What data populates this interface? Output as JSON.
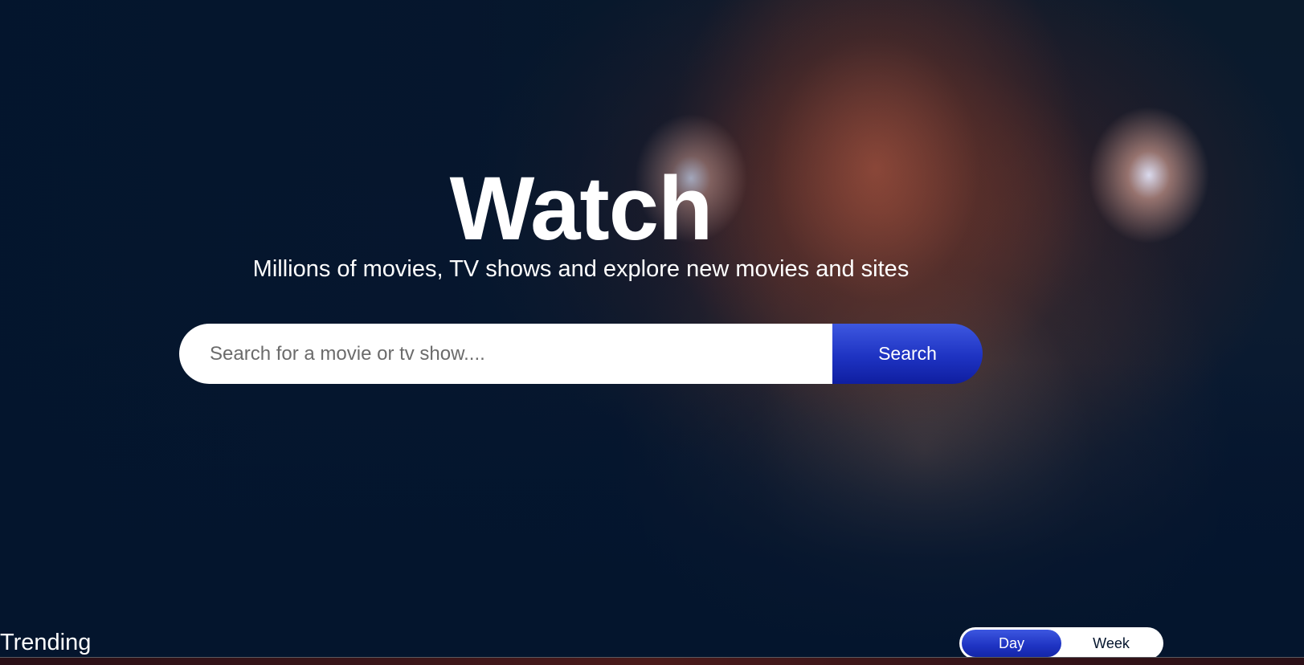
{
  "hero": {
    "title": "Watch",
    "subtitle": "Millions of movies, TV shows and explore new movies and sites"
  },
  "search": {
    "placeholder": "Search for a movie or tv show....",
    "value": "",
    "button_label": "Search"
  },
  "trending": {
    "title": "Trending",
    "toggle": [
      {
        "label": "Day",
        "active": true
      },
      {
        "label": "Week",
        "active": false
      }
    ]
  },
  "colors": {
    "background": "#04152d",
    "accent": "#1e33c2",
    "text": "#ffffff"
  }
}
